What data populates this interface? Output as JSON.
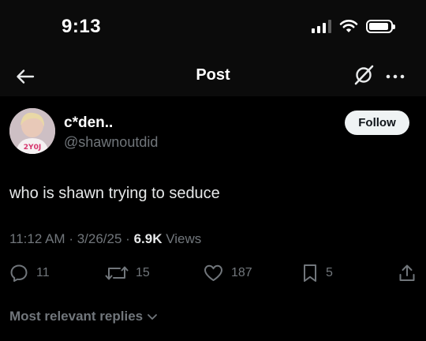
{
  "status_bar": {
    "time": "9:13"
  },
  "nav": {
    "title": "Post"
  },
  "author": {
    "display_name": "c*den..",
    "handle": "@shawnoutdid",
    "follow_label": "Follow"
  },
  "post": {
    "text": "who is shawn trying to seduce",
    "time": "11:12 AM",
    "date": "3/26/25",
    "views_count": "6.9K",
    "views_label": "Views"
  },
  "actions": {
    "replies": "11",
    "reposts": "15",
    "likes": "187",
    "bookmarks": "5"
  },
  "replies_sort": {
    "label": "Most relevant replies"
  },
  "icons": [
    "back-arrow-icon",
    "grok-icon",
    "more-icon",
    "reply-icon",
    "repost-icon",
    "like-icon",
    "bookmark-icon",
    "share-icon",
    "chevron-down-icon",
    "signal-icon",
    "wifi-icon",
    "battery-icon"
  ],
  "colors": {
    "background": "#000000",
    "text": "#e7e9ea",
    "secondary": "#71767b",
    "follow_bg": "#eff3f4"
  }
}
